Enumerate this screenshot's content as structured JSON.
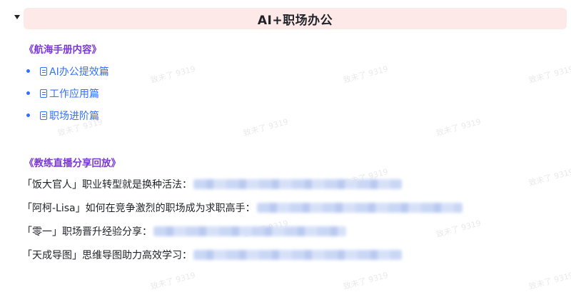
{
  "header": {
    "title": "AI+职场办公"
  },
  "handbook": {
    "heading": "《航海手册内容》",
    "items": [
      {
        "label": "AI办公提效篇",
        "icon": "document-icon"
      },
      {
        "label": "工作应用篇",
        "icon": "document-icon"
      },
      {
        "label": "职场进阶篇",
        "icon": "document-icon"
      }
    ]
  },
  "replays": {
    "heading": "《教练直播分享回放》",
    "items": [
      {
        "label": "「饭大官人」职业转型就是换种活法："
      },
      {
        "label": "「阿柯-Lisa」如何在竞争激烈的职场成为求职高手："
      },
      {
        "label": "「零一」职场晋升经验分享："
      },
      {
        "label": "「天成导图」思维导图助力高效学习："
      }
    ]
  },
  "watermark": {
    "text": "致未了 9319"
  },
  "colors": {
    "title_bg": "#fde9e8",
    "heading": "#7a39d6",
    "link": "#3370ff"
  }
}
